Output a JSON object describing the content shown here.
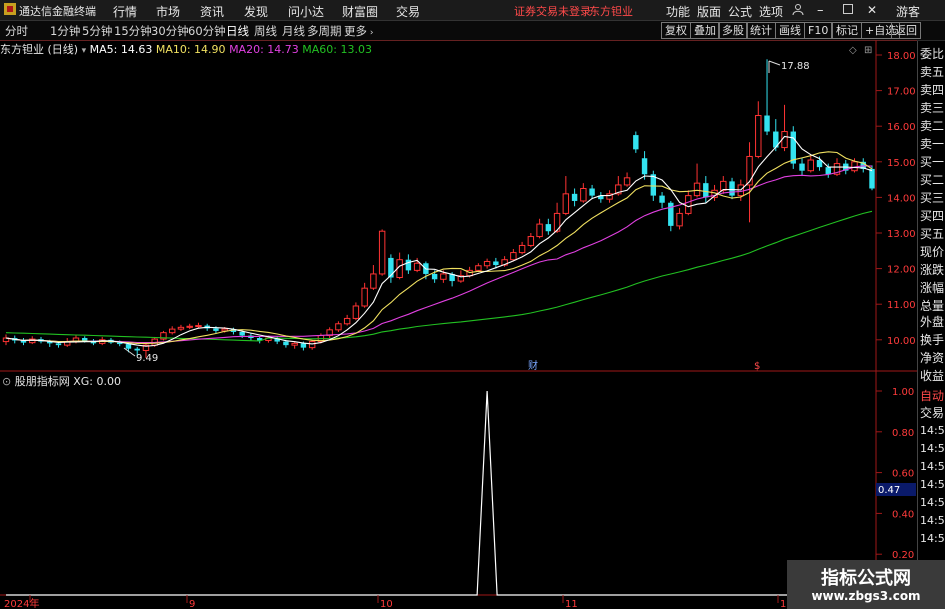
{
  "menubar": {
    "app_name": "通达信金融终端",
    "left_items": [
      "行情",
      "市场",
      "资讯",
      "发现",
      "问小达",
      "财富圈",
      "交易"
    ],
    "status_text": "证券交易未登录",
    "stock_name": "东方钽业",
    "right_items": [
      "功能",
      "版面",
      "公式",
      "选项"
    ],
    "guest_label": "游客"
  },
  "toolbar": {
    "periods": [
      "分时",
      "1分钟",
      "5分钟",
      "15分钟",
      "30分钟",
      "60分钟",
      "日线",
      "周线",
      "月线",
      "多周期",
      "更多"
    ],
    "active_period": "日线",
    "right_buttons": [
      "复权",
      "叠加",
      "多股",
      "统计",
      "画线",
      "F10",
      "标记",
      "+自选",
      "返回"
    ]
  },
  "chart_info": {
    "title": "东方钽业 (日线)",
    "ma5": "MA5: 14.63",
    "ma10": "MA10: 14.90",
    "ma20": "MA20: 14.73",
    "ma60": "MA60: 13.03"
  },
  "indicator_info": {
    "title": "股朋指标网",
    "value": "XG: 0.00"
  },
  "right_panel": {
    "items": [
      "委比",
      "卖五",
      "卖四",
      "卖三",
      "卖二",
      "卖一",
      "买一",
      "买二",
      "买三",
      "买四",
      "买五",
      "现价",
      "涨跌",
      "涨幅",
      "总量",
      "外盘",
      "换手",
      "净资",
      "收益",
      "自动",
      "交易"
    ],
    "times": [
      "14:56",
      "14:56",
      "14:56",
      "14:56",
      "14:56",
      "14:56",
      "14:56"
    ]
  },
  "cursor_value": "0.47",
  "markers": {
    "high_label": "17.88",
    "low_label": "9.49",
    "finance_mark": "财",
    "dollar_mark": "$"
  },
  "watermark": {
    "line1": "指标公式网",
    "line2": "www.zbgs3.com"
  },
  "colors": {
    "up": "#ff3333",
    "down": "#33e3f0",
    "ma5": "#ffffff",
    "ma10": "#f0e060",
    "ma20": "#e040e0",
    "ma60": "#22c022",
    "axis": "#a01818"
  },
  "chart_data": [
    {
      "type": "candlestick",
      "title": "东方钽业 (日线)",
      "y_axis_ticks": [
        18.0,
        17.0,
        16.0,
        15.0,
        14.0,
        13.0,
        12.0,
        11.0,
        10.0
      ],
      "ylim": [
        9.2,
        18.2
      ],
      "x_ticks": [
        "2024年",
        "9",
        "10",
        "11",
        "12"
      ],
      "annotations": [
        {
          "label": "17.88",
          "value": 17.88
        },
        {
          "label": "9.49",
          "value": 9.49
        }
      ],
      "series_ma": [
        {
          "name": "MA5",
          "last": 14.63
        },
        {
          "name": "MA10",
          "last": 14.9
        },
        {
          "name": "MA20",
          "last": 14.73
        },
        {
          "name": "MA60",
          "last": 13.03
        }
      ],
      "candles": [
        [
          9.95,
          10.05,
          10.15,
          9.85
        ],
        [
          10.05,
          9.98,
          10.12,
          9.9
        ],
        [
          9.98,
          9.92,
          10.05,
          9.85
        ],
        [
          9.92,
          10.02,
          10.1,
          9.88
        ],
        [
          10.02,
          9.95,
          10.08,
          9.9
        ],
        [
          9.95,
          9.9,
          10.0,
          9.8
        ],
        [
          9.9,
          9.85,
          9.95,
          9.78
        ],
        [
          9.85,
          9.95,
          10.05,
          9.8
        ],
        [
          9.95,
          10.05,
          10.12,
          9.9
        ],
        [
          10.05,
          9.98,
          10.1,
          9.92
        ],
        [
          9.98,
          9.9,
          10.02,
          9.85
        ],
        [
          9.9,
          10.0,
          10.08,
          9.85
        ],
        [
          10.0,
          9.92,
          10.05,
          9.88
        ],
        [
          9.92,
          9.88,
          9.98,
          9.82
        ],
        [
          9.88,
          9.75,
          9.92,
          9.65
        ],
        [
          9.75,
          9.7,
          9.8,
          9.55
        ],
        [
          9.7,
          9.85,
          9.9,
          9.49
        ],
        [
          9.85,
          10.02,
          10.08,
          9.8
        ],
        [
          10.02,
          10.2,
          10.25,
          9.98
        ],
        [
          10.2,
          10.3,
          10.38,
          10.15
        ],
        [
          10.3,
          10.35,
          10.42,
          10.25
        ],
        [
          10.35,
          10.38,
          10.45,
          10.3
        ],
        [
          10.38,
          10.4,
          10.48,
          10.32
        ],
        [
          10.4,
          10.32,
          10.45,
          10.25
        ],
        [
          10.32,
          10.25,
          10.38,
          10.18
        ],
        [
          10.25,
          10.3,
          10.36,
          10.2
        ],
        [
          10.3,
          10.22,
          10.34,
          10.15
        ],
        [
          10.22,
          10.12,
          10.26,
          10.05
        ],
        [
          10.12,
          10.05,
          10.18,
          9.98
        ],
        [
          10.05,
          9.98,
          10.1,
          9.9
        ],
        [
          9.98,
          10.05,
          10.12,
          9.92
        ],
        [
          10.05,
          9.95,
          10.1,
          9.88
        ],
        [
          9.95,
          9.85,
          10.0,
          9.78
        ],
        [
          9.85,
          9.9,
          9.96,
          9.75
        ],
        [
          9.9,
          9.78,
          9.95,
          9.7
        ],
        [
          9.78,
          9.95,
          10.0,
          9.72
        ],
        [
          9.95,
          10.12,
          10.18,
          9.9
        ],
        [
          10.12,
          10.28,
          10.35,
          10.05
        ],
        [
          10.28,
          10.45,
          10.52,
          10.22
        ],
        [
          10.45,
          10.6,
          10.7,
          10.4
        ],
        [
          10.6,
          10.95,
          11.05,
          10.55
        ],
        [
          10.95,
          11.45,
          11.6,
          10.9
        ],
        [
          11.45,
          11.85,
          12.1,
          11.4
        ],
        [
          11.85,
          13.05,
          13.1,
          11.8
        ],
        [
          12.3,
          11.75,
          12.4,
          11.6
        ],
        [
          11.75,
          12.25,
          12.45,
          11.7
        ],
        [
          12.25,
          11.95,
          12.4,
          11.85
        ],
        [
          11.95,
          12.15,
          12.3,
          11.9
        ],
        [
          12.15,
          11.85,
          12.2,
          11.7
        ],
        [
          11.85,
          11.7,
          11.95,
          11.6
        ],
        [
          11.7,
          11.85,
          11.95,
          11.6
        ],
        [
          11.85,
          11.65,
          11.9,
          11.5
        ],
        [
          11.65,
          11.8,
          11.95,
          11.6
        ],
        [
          11.8,
          11.95,
          12.05,
          11.75
        ],
        [
          11.95,
          12.08,
          12.15,
          11.9
        ],
        [
          12.08,
          12.2,
          12.28,
          12.0
        ],
        [
          12.2,
          12.1,
          12.3,
          12.0
        ],
        [
          12.1,
          12.25,
          12.35,
          12.05
        ],
        [
          12.25,
          12.45,
          12.55,
          12.2
        ],
        [
          12.45,
          12.65,
          12.75,
          12.4
        ],
        [
          12.65,
          12.9,
          13.0,
          12.6
        ],
        [
          12.9,
          13.25,
          13.4,
          12.85
        ],
        [
          13.25,
          13.05,
          13.4,
          12.95
        ],
        [
          13.05,
          13.55,
          13.85,
          13.0
        ],
        [
          13.55,
          14.1,
          14.6,
          13.5
        ],
        [
          14.1,
          13.9,
          14.25,
          13.75
        ],
        [
          13.9,
          14.25,
          14.4,
          13.85
        ],
        [
          14.25,
          14.05,
          14.35,
          13.95
        ],
        [
          14.05,
          13.95,
          14.15,
          13.85
        ],
        [
          13.95,
          14.1,
          14.2,
          13.85
        ],
        [
          14.1,
          14.35,
          14.6,
          14.05
        ],
        [
          14.35,
          14.55,
          14.7,
          14.3
        ],
        [
          15.75,
          15.35,
          15.85,
          15.25
        ],
        [
          15.1,
          14.65,
          15.3,
          14.5
        ],
        [
          14.65,
          14.05,
          14.75,
          13.9
        ],
        [
          14.05,
          13.85,
          14.15,
          13.7
        ],
        [
          13.85,
          13.2,
          13.9,
          13.05
        ],
        [
          13.2,
          13.55,
          13.7,
          13.1
        ],
        [
          13.55,
          14.05,
          14.2,
          13.5
        ],
        [
          14.05,
          14.4,
          14.95,
          14.0
        ],
        [
          14.4,
          14.0,
          14.6,
          13.85
        ],
        [
          14.0,
          14.2,
          14.35,
          13.9
        ],
        [
          14.2,
          14.45,
          14.6,
          14.1
        ],
        [
          14.45,
          14.05,
          14.55,
          13.95
        ],
        [
          14.05,
          14.35,
          14.5,
          13.9
        ],
        [
          14.35,
          15.15,
          15.55,
          13.3
        ],
        [
          15.15,
          16.3,
          16.7,
          15.1
        ],
        [
          16.3,
          15.85,
          17.88,
          15.75
        ],
        [
          15.85,
          15.4,
          16.2,
          15.3
        ],
        [
          15.4,
          15.85,
          16.6,
          15.3
        ],
        [
          15.85,
          14.95,
          16.0,
          14.8
        ],
        [
          14.95,
          14.75,
          15.1,
          14.6
        ],
        [
          14.75,
          15.05,
          15.2,
          14.7
        ],
        [
          15.05,
          14.85,
          15.15,
          14.75
        ],
        [
          14.85,
          14.65,
          14.95,
          14.55
        ],
        [
          14.65,
          14.95,
          15.1,
          14.6
        ],
        [
          14.95,
          14.75,
          15.05,
          14.65
        ],
        [
          14.75,
          15.0,
          15.1,
          14.7
        ],
        [
          15.0,
          14.8,
          15.1,
          14.7
        ],
        [
          14.8,
          14.25,
          14.9,
          14.2
        ]
      ]
    },
    {
      "type": "line",
      "title": "股朋指标网",
      "series": [
        {
          "name": "XG",
          "values_note": "single spike"
        }
      ],
      "y_axis_ticks": [
        1.0,
        0.8,
        0.6,
        0.47,
        0.4,
        0.2
      ],
      "ylim": [
        0,
        1
      ],
      "spike_index": 55,
      "spike_value": 1.0
    }
  ]
}
